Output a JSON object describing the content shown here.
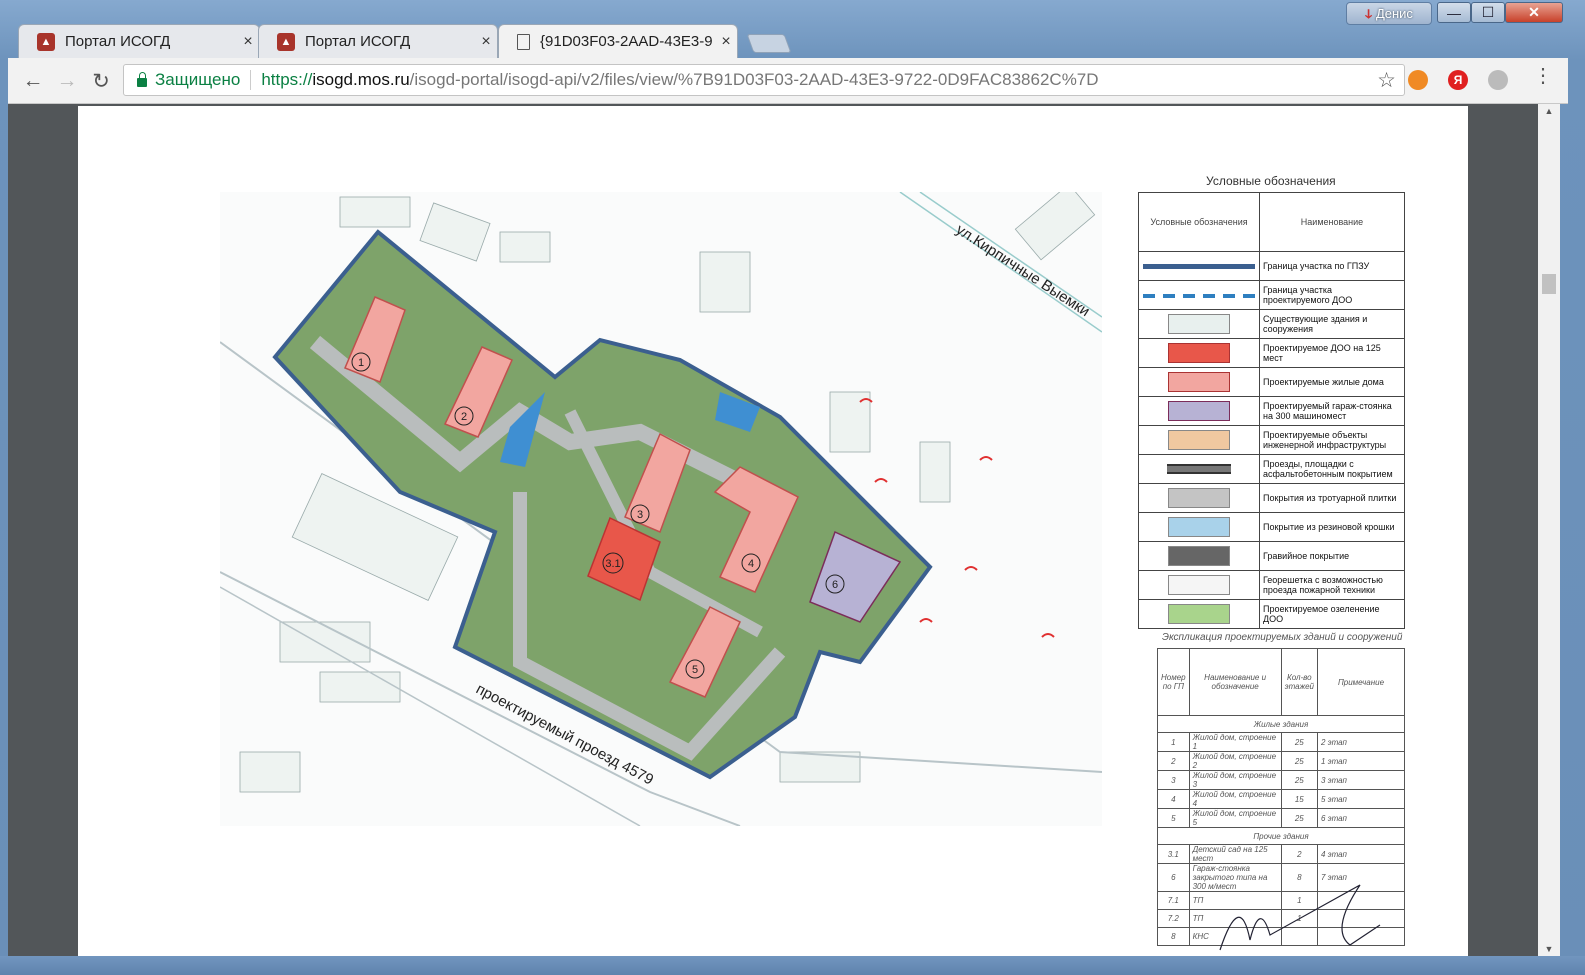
{
  "window": {
    "user_icon": "ↆ",
    "user_name": "Денис",
    "minimize": "—",
    "maximize": "☐",
    "close": "✕"
  },
  "tabs": [
    {
      "label": "Портал ИСОГД",
      "close": "×"
    },
    {
      "label": "Портал ИСОГД",
      "close": "×"
    },
    {
      "label": "{91D03F03-2AAD-43E3-9",
      "close": "×"
    }
  ],
  "toolbar": {
    "back": "←",
    "forward": "→",
    "reload": "↻",
    "secure_label": "Защищено",
    "url_scheme": "https://",
    "url_host": "isogd.mos.ru",
    "url_path": "/isogd-portal/isogd-api/v2/files/view/%7B91D03F03-2AAD-43E3-9722-0D9FAC83862C%7D",
    "star": "☆",
    "yandex": "Я",
    "menu": "⋮"
  },
  "map": {
    "street_top": "ул.Кирпичные Выемки",
    "street_bottom": "проектируемый проезд 4579",
    "building_labels": [
      "1",
      "2",
      "3",
      "3.1",
      "4",
      "5",
      "6"
    ]
  },
  "legend": {
    "title": "Условные обозначения",
    "header_symbol": "Условные обозначения",
    "header_name": "Наименование",
    "items": [
      {
        "name": "Граница участка по ГПЗУ",
        "color": "#3b5f8f"
      },
      {
        "name": "Граница участка проектируемого ДОО",
        "color": "#2e7fc0"
      },
      {
        "name": "Существующие здания и сооружения",
        "color": "#e8f0ee"
      },
      {
        "name": "Проектируемое ДОО на 125 мест",
        "color": "#e8574a"
      },
      {
        "name": "Проектируемые жилые дома",
        "color": "#f2a6a0"
      },
      {
        "name": "Проектируемый гараж-стоянка на 300 машиномест",
        "color": "#b7b2d4"
      },
      {
        "name": "Проектируемые объекты инженерной инфраструктуры",
        "color": "#f0c8a0"
      },
      {
        "name": "Проезды, площадки с асфальтобетонным покрытием",
        "color": "#333333"
      },
      {
        "name": "Покрытия из тротуарной плитки",
        "color": "#c4c4c4"
      },
      {
        "name": "Покрытие из резиновой крошки",
        "color": "#a9d2ea"
      },
      {
        "name": "Гравийное покрытие",
        "color": "#666666"
      },
      {
        "name": "Георешетка с возможностью проезда пожарной техники",
        "color": "#f5f5f5"
      },
      {
        "name": "Проектируемое озеленение ДОО",
        "color": "#a9d48c"
      }
    ]
  },
  "explication": {
    "title": "Экспликация проектируемых зданий и сооружений",
    "headers": [
      "Номер по ГП",
      "Наименование и обозначение",
      "Кол-во этажей",
      "Примечание"
    ],
    "group1": "Жилые здания",
    "group2": "Прочие здания",
    "rows1": [
      [
        "1",
        "Жилой дом, строение 1",
        "25",
        "2 этап"
      ],
      [
        "2",
        "Жилой дом, строение 2",
        "25",
        "1 этап"
      ],
      [
        "3",
        "Жилой дом, строение 3",
        "25",
        "3 этап"
      ],
      [
        "4",
        "Жилой дом, строение 4",
        "15",
        "5 этап"
      ],
      [
        "5",
        "Жилой дом, строение 5",
        "25",
        "6 этап"
      ]
    ],
    "rows2": [
      [
        "3.1",
        "Детский сад на 125 мест",
        "2",
        "4 этап"
      ],
      [
        "6",
        "Гараж-стоянка закрытого типа на 300 м/мест",
        "8",
        "7 этап"
      ],
      [
        "7.1",
        "ТП",
        "1",
        ""
      ],
      [
        "7.2",
        "ТП",
        "1",
        ""
      ],
      [
        "8",
        "КНС",
        "",
        ""
      ]
    ]
  }
}
